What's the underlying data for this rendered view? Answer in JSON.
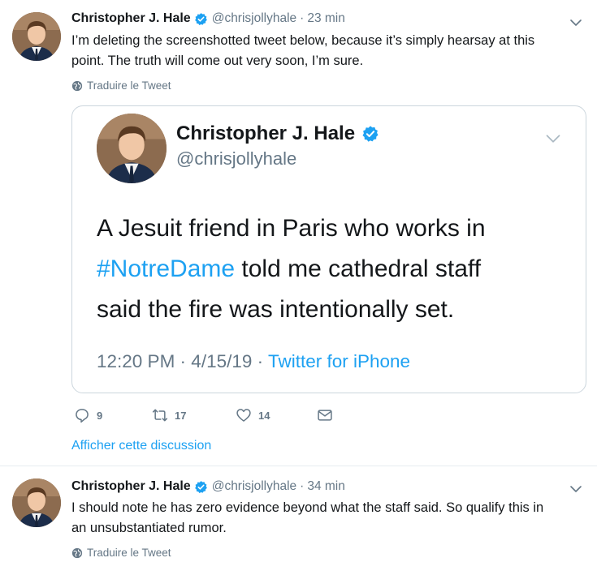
{
  "tweet1": {
    "author_name": "Christopher J. Hale",
    "handle": "@chrisjollyhale",
    "separator": "·",
    "time": "23 min",
    "text_line1": "I’m deleting the screenshotted tweet below, because it’s simply hearsay at this",
    "text_line2": "point. The truth will come out very soon, I’m sure.",
    "translate_label": "Traduire le Tweet",
    "quoted_screenshot": {
      "author_name": "Christopher J. Hale",
      "handle": "@chrisjollyhale",
      "text_line1": "A Jesuit friend in Paris who works in",
      "hashtag": "#NotreDame",
      "text_line2_rest": " told me cathedral staff",
      "text_line3": "said the fire was intentionally set.",
      "meta_time": "12:20 PM · 4/15/19 · ",
      "meta_source": "Twitter for iPhone"
    },
    "actions": {
      "replies": "9",
      "retweets": "17",
      "likes": "14"
    },
    "show_thread_label": "Afficher cette discussion"
  },
  "tweet2": {
    "author_name": "Christopher J. Hale",
    "handle": "@chrisjollyhale",
    "separator": "·",
    "time": "34 min",
    "text_line1": "I should note he has zero evidence beyond what the staff said. So qualify this in",
    "text_line2": "an unsubstantiated rumor.",
    "translate_label": "Traduire le Tweet"
  },
  "colors": {
    "accent": "#1da1f2",
    "secondary_text": "#657786",
    "border": "#ccd6dd",
    "primary_text": "#14171a"
  },
  "icons": [
    "verified-badge-icon",
    "chevron-down-icon",
    "globe-icon",
    "reply-icon",
    "retweet-icon",
    "like-icon",
    "message-icon"
  ]
}
